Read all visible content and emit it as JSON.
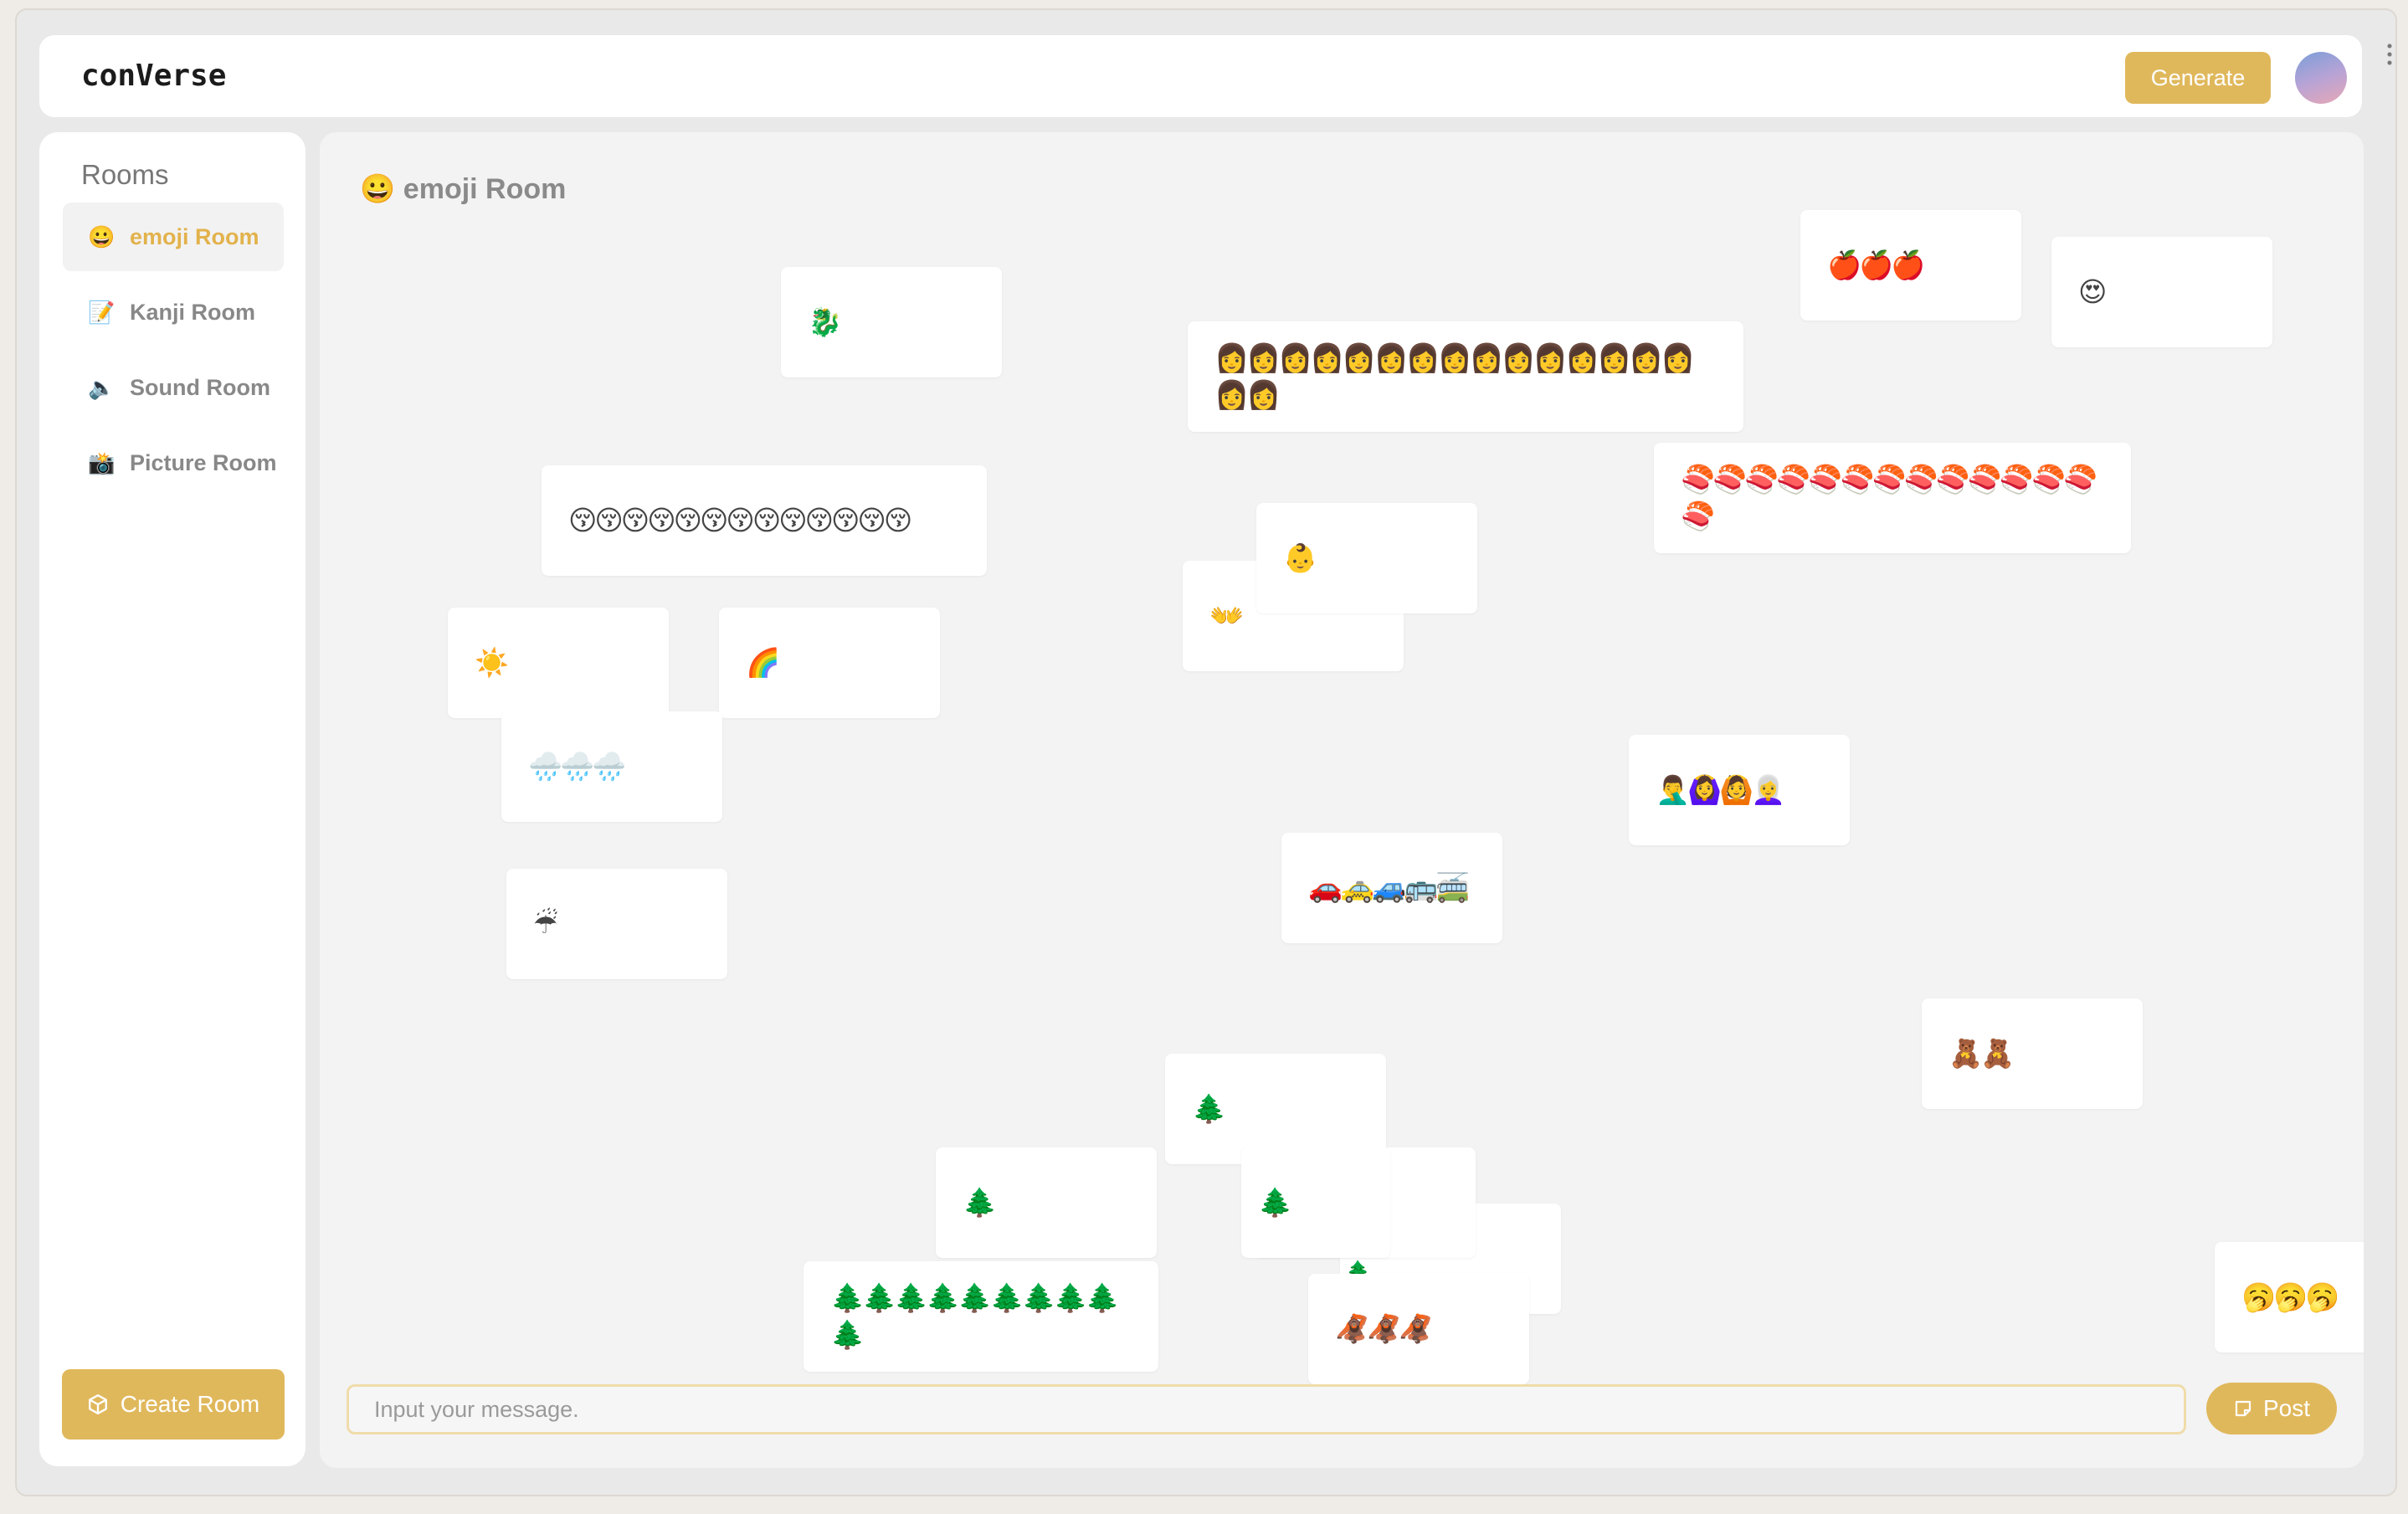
{
  "header": {
    "brand": "conVerse",
    "generate_label": "Generate"
  },
  "sidebar": {
    "title": "Rooms",
    "items": [
      {
        "icon": "😀",
        "label": "emoji Room",
        "active": true
      },
      {
        "icon": "📝",
        "label": "Kanji Room",
        "active": false
      },
      {
        "icon": "🔈",
        "label": "Sound Room",
        "active": false
      },
      {
        "icon": "📸",
        "label": "Picture Room",
        "active": false
      }
    ],
    "create_label": "Create Room",
    "create_icon": "cube-icon"
  },
  "room": {
    "icon": "😀",
    "title": "emoji Room"
  },
  "messages": [
    {
      "text": "🐉"
    },
    {
      "text": "👩👩👩👩👩👩👩👩👩👩👩👩👩👩👩👩👩"
    },
    {
      "text": "🍎🍎🍎"
    },
    {
      "text": "😍"
    },
    {
      "text": "😚😚😚😚😚😚😚😚😚😚😚😚😚"
    },
    {
      "text": "🍣🍣🍣🍣🍣🍣🍣🍣🍣🍣🍣🍣🍣🍣"
    },
    {
      "text": "👐"
    },
    {
      "text": "👶"
    },
    {
      "text": "☀️"
    },
    {
      "text": "🌈"
    },
    {
      "text": "🌧️🌧️🌧️"
    },
    {
      "text": "🤦‍♂️🙆‍♀️🙆👩‍🦳"
    },
    {
      "text": "☔"
    },
    {
      "text": "🚗🚕🚙🚌🚎"
    },
    {
      "text": "🧸🧸"
    },
    {
      "text": "🌲"
    },
    {
      "text": "🌲"
    },
    {
      "text": "🌲"
    },
    {
      "text": "🌲"
    },
    {
      "text": "🌲🌲🌲🌲🌲🌲🌲🌲🌲🌲"
    },
    {
      "text": "🦧🦧🦧"
    },
    {
      "text": "🥱🥱🥱"
    }
  ],
  "composer": {
    "placeholder": "Input your message.",
    "post_label": "Post",
    "post_icon": "note-icon"
  },
  "colors": {
    "accent": "#e0b85c",
    "active_text": "#e2b24c",
    "canvas": "#f3f3f3"
  }
}
